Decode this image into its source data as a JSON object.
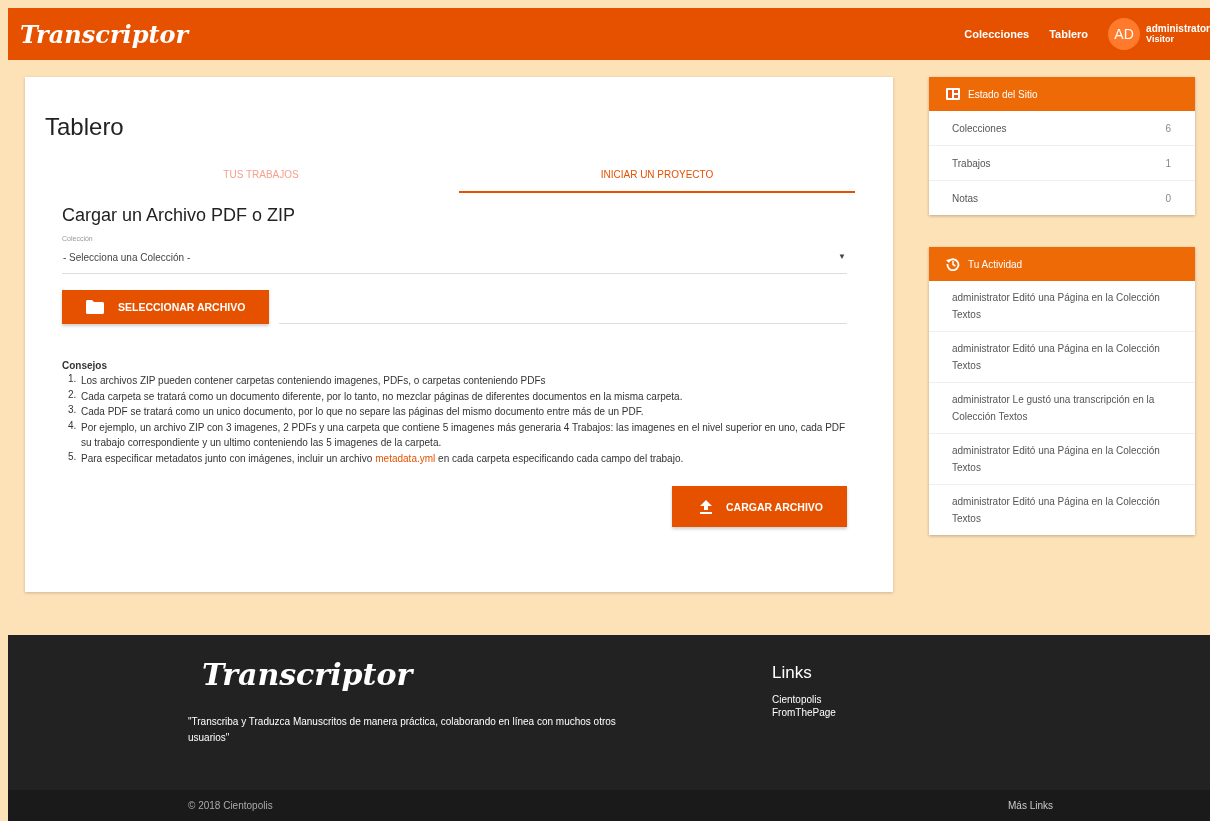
{
  "header": {
    "logo": "Transcriptor",
    "nav": [
      "Colecciones",
      "Tablero"
    ],
    "avatar": "AD",
    "user": "administrator",
    "role": "Visitor"
  },
  "main": {
    "title": "Tablero",
    "tabs": [
      {
        "label": "TUS TRABAJOS",
        "selected": false
      },
      {
        "label": "INICIAR UN PROYECTO",
        "selected": true
      }
    ],
    "upload_title": "Cargar un Archivo PDF o ZIP",
    "collection_field": {
      "label": "Colección",
      "value": "- Selecciona una Colección -",
      "caret": "▼"
    },
    "select_button": "SELECCIONAR ARCHIVO",
    "tips_title": "Consejos",
    "tips": [
      {
        "number": "1.",
        "text": "Los archivos ZIP pueden contener carpetas conteniendo imagenes, PDFs, o carpetas conteniendo PDFs"
      },
      {
        "number": "2.",
        "text": "Cada carpeta se tratará como un documento diferente, por lo tanto, no mezclar páginas de diferentes documentos en la misma carpeta."
      },
      {
        "number": "3.",
        "text": "Cada PDF se tratará como un unico documento, por lo que no separe las páginas del mismo documento entre más de un PDF."
      },
      {
        "number": "4.",
        "text": "Por ejemplo, un archivo ZIP con 3 imagenes, 2 PDFs y una carpeta que contiene 5 imagenes más generaria 4 Trabajos: las imagenes en el nivel superior en uno, cada PDF su trabajo correspondiente y un ultimo conteniendo las 5 imagenes de la carpeta."
      },
      {
        "number": "5.",
        "text": "Para especificar metadatos junto con imágenes, incluir un archivo",
        "link": "metadata.yml",
        "after": "en cada carpeta especificando cada campo del trabajo."
      }
    ],
    "upload_button": "CARGAR ARCHIVO"
  },
  "sidebar": {
    "status": {
      "title": "Estado del Sitio",
      "rows": [
        {
          "label": "Colecciones",
          "value": "6"
        },
        {
          "label": "Trabajos",
          "value": "1"
        },
        {
          "label": "Notas",
          "value": "0"
        }
      ]
    },
    "activity": {
      "title": "Tu Actividad",
      "items": [
        "administrator Editó una Página en la Colección Textos",
        "administrator Editó una Página en la Colección Textos",
        "administrator Le gustó una transcripción en la Colección Textos",
        "administrator Editó una Página en la Colección Textos",
        "administrator Editó una Página en la Colección Textos"
      ]
    }
  },
  "footer": {
    "logo": "Transcriptor",
    "quote": "\"Transcriba y Traduzca Manuscritos de manera práctica, colaborando en línea con muchos otros usuarios\"",
    "links_title": "Links",
    "links": [
      "Cientopolis",
      "FromThePage"
    ],
    "copyright": "© 2018 Cientopolis",
    "more": "Más Links"
  }
}
